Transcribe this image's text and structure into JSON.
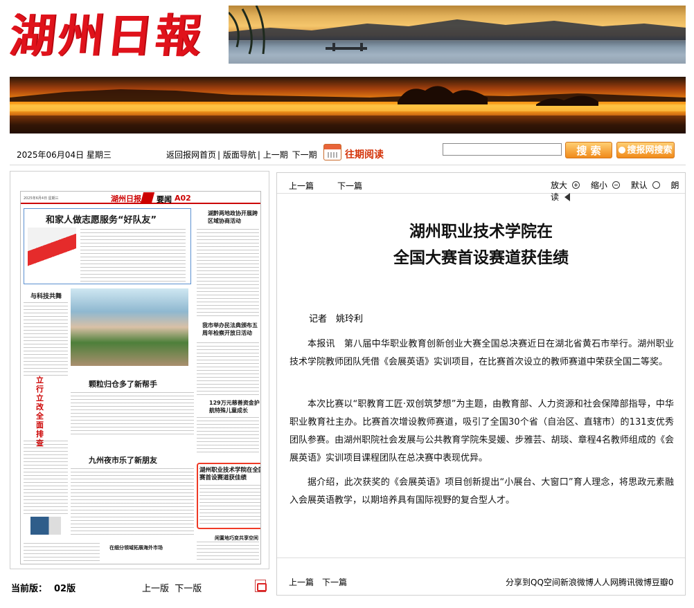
{
  "header": {
    "logo_text": "湖州日報"
  },
  "toolbar": {
    "date": "2025年06月04日",
    "weekday": "星期三",
    "links": [
      "返回报网首页",
      "版面导航",
      "上一期",
      "下一期"
    ],
    "past_issues": "往期阅读",
    "search_button": "搜 索",
    "site_search_button": "搜报网搜索"
  },
  "left": {
    "thumb": {
      "masthead_small": "2025年6月4日 星期三",
      "masthead_name": "湖州日报",
      "section": "要闻",
      "page_code": "A02",
      "h1": "和家人做志愿服务“好队友”",
      "h2": "湖黔两地政协开展跨区域协商活动",
      "h3": "与科技共舞",
      "h4": "我市举办民法典颁布五周年检察开放日活动",
      "h5": "颗粒归仓多了新帮手",
      "h6": "129万元慈善资金护航特殊儿童成长",
      "h7": "立行立改 全面排查",
      "h8": "九州夜市乐了新朋友",
      "h9": "湖州职业技术学院在全国大赛首设赛道获佳绩",
      "h10": "闲置地巧变共享空间",
      "h11": "在细分领域拓展海外市场"
    },
    "current_edition_label": "当前版：",
    "current_edition_value": "02版",
    "prev_page": "上一版",
    "next_page": "下一版"
  },
  "article": {
    "prev": "上一篇",
    "next": "下一篇",
    "zoom_in": "放大",
    "zoom_out": "缩小",
    "default": "默认",
    "read": "朗读",
    "title_line1": "湖州职业技术学院在",
    "title_line2": "全国大赛首设赛道获佳绩",
    "byline": "记者　姚玲利",
    "p1": "本报讯　第八届中华职业教育创新创业大赛全国总决赛近日在湖北省黄石市举行。湖州职业技术学院教师团队凭借《会展英语》实训项目，在比赛首次设立的教师赛道中荣获全国二等奖。",
    "p2": "本次比赛以“职教育工匠·双创筑梦想”为主题，由教育部、人力资源和社会保障部指导，中华职业教育社主办。比赛首次增设教师赛道，吸引了全国30个省（自治区、直辖市）的131支优秀团队参赛。由湖州职院社会发展与公共教育学院朱旻媛、步雅芸、胡琰、章程4名教师组成的《会展英语》实训项目课程团队在总决赛中表现优异。",
    "p3": "据介绍，此次获奖的《会展英语》项目创新提出“小展台、大窗口”育人理念，将思政元素融入会展英语教学，以期培养具有国际视野的复合型人才。",
    "bottom_prev": "上一篇",
    "bottom_next": "下一篇",
    "share": "分享到QQ空间新浪微博人人网腾讯微博豆瓣0"
  }
}
